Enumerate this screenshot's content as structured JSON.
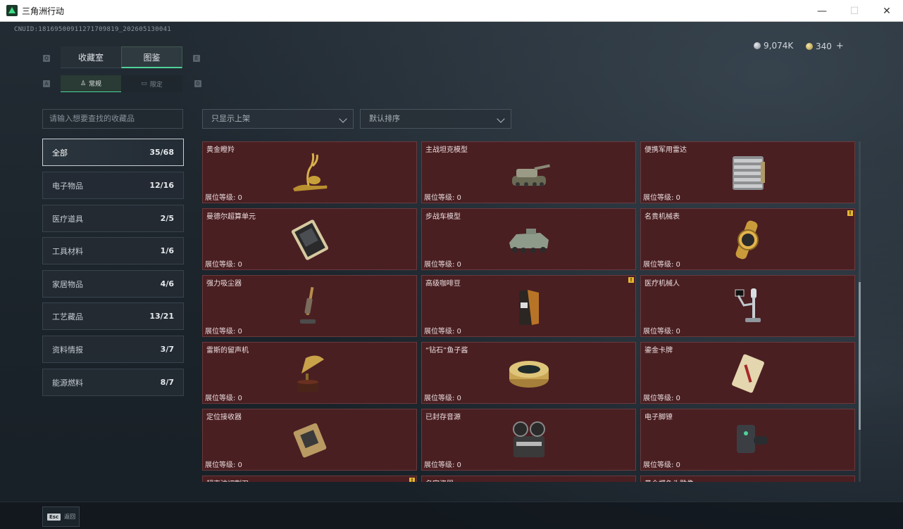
{
  "window": {
    "title": "三角洲行动",
    "minimize": "—",
    "maximize": "☐",
    "close": "✕"
  },
  "header": {
    "uid": "CNUID:1816950091127170981​9_202605130041",
    "currency": [
      {
        "icon": "silver-coin-icon",
        "value": "9,074K"
      },
      {
        "icon": "gold-coin-icon",
        "value": "340"
      }
    ],
    "add_label": "+"
  },
  "tabs": {
    "left_key": "Q",
    "right_key": "E",
    "items": [
      {
        "label": "收藏室",
        "active": false
      },
      {
        "label": "图鉴",
        "active": true
      }
    ]
  },
  "subtabs": {
    "left_key": "A",
    "right_key": "D",
    "items": [
      {
        "label": "常规",
        "icon": "trophy-icon",
        "active": true
      },
      {
        "label": "限定",
        "icon": "box-icon",
        "active": false
      }
    ]
  },
  "search": {
    "placeholder": "请输入想要查找的收藏品"
  },
  "filters": [
    {
      "label": "只显示上架"
    },
    {
      "label": "默认排序"
    }
  ],
  "categories": [
    {
      "label": "全部",
      "count": "35/68",
      "active": true
    },
    {
      "label": "电子物品",
      "count": "12/16",
      "active": false
    },
    {
      "label": "医疗道具",
      "count": "2/5",
      "active": false
    },
    {
      "label": "工具材料",
      "count": "1/6",
      "active": false
    },
    {
      "label": "家居物品",
      "count": "4/6",
      "active": false
    },
    {
      "label": "工艺藏品",
      "count": "13/21",
      "active": false
    },
    {
      "label": "资料情报",
      "count": "3/7",
      "active": false
    },
    {
      "label": "能源燃料",
      "count": "8/7",
      "active": false
    }
  ],
  "items": [
    {
      "name": "黄金瞪羚",
      "level": "展位等级: 0",
      "icon": "gold-gazelle-icon",
      "badge": false
    },
    {
      "name": "主战坦克模型",
      "level": "展位等级: 0",
      "icon": "tank-model-icon",
      "badge": false
    },
    {
      "name": "便携军用雷达",
      "level": "展位等级: 0",
      "icon": "portable-radar-icon",
      "badge": false
    },
    {
      "name": "曼德尔超算单元",
      "level": "展位等级: 0",
      "icon": "supercomputer-unit-icon",
      "badge": false
    },
    {
      "name": "步战车模型",
      "level": "展位等级: 0",
      "icon": "ifv-model-icon",
      "badge": false
    },
    {
      "name": "名贵机械表",
      "level": "展位等级: 0",
      "icon": "luxury-watch-icon",
      "badge": true
    },
    {
      "name": "强力吸尘器",
      "level": "展位等级: 0",
      "icon": "vacuum-cleaner-icon",
      "badge": false
    },
    {
      "name": "高级咖啡豆",
      "level": "展位等级: 0",
      "icon": "coffee-beans-icon",
      "badge": true
    },
    {
      "name": "医疗机械人",
      "level": "展位等级: 0",
      "icon": "medical-robot-icon",
      "badge": false
    },
    {
      "name": "雷斯的留声机",
      "level": "展位等级: 0",
      "icon": "gramophone-icon",
      "badge": false
    },
    {
      "name": "“钻石”鱼子酱",
      "level": "展位等级: 0",
      "icon": "caviar-tin-icon",
      "badge": false
    },
    {
      "name": "鎏金卡牌",
      "level": "展位等级: 0",
      "icon": "gilded-card-icon",
      "badge": false
    },
    {
      "name": "定位接收器",
      "level": "展位等级: 0",
      "icon": "locator-receiver-icon",
      "badge": false
    },
    {
      "name": "已封存音源",
      "level": "展位等级: 0",
      "icon": "reel-recorder-icon",
      "badge": false
    },
    {
      "name": "电子脚镣",
      "level": "展位等级: 0",
      "icon": "electronic-anklet-icon",
      "badge": false
    },
    {
      "name": "超声波切割刀",
      "level": "",
      "icon": "",
      "badge": true
    },
    {
      "name": "名家瓷器",
      "level": "",
      "icon": "",
      "badge": false
    },
    {
      "name": "黄金蝶鱼头雕像",
      "level": "",
      "icon": "",
      "badge": false
    }
  ],
  "badge_mark": "!",
  "bottom": {
    "esc_key": "Esc",
    "back_label": "返回"
  },
  "colors": {
    "accent": "#4fd29a",
    "card_bg": "#4a1f22",
    "badge": "#e5b633"
  }
}
